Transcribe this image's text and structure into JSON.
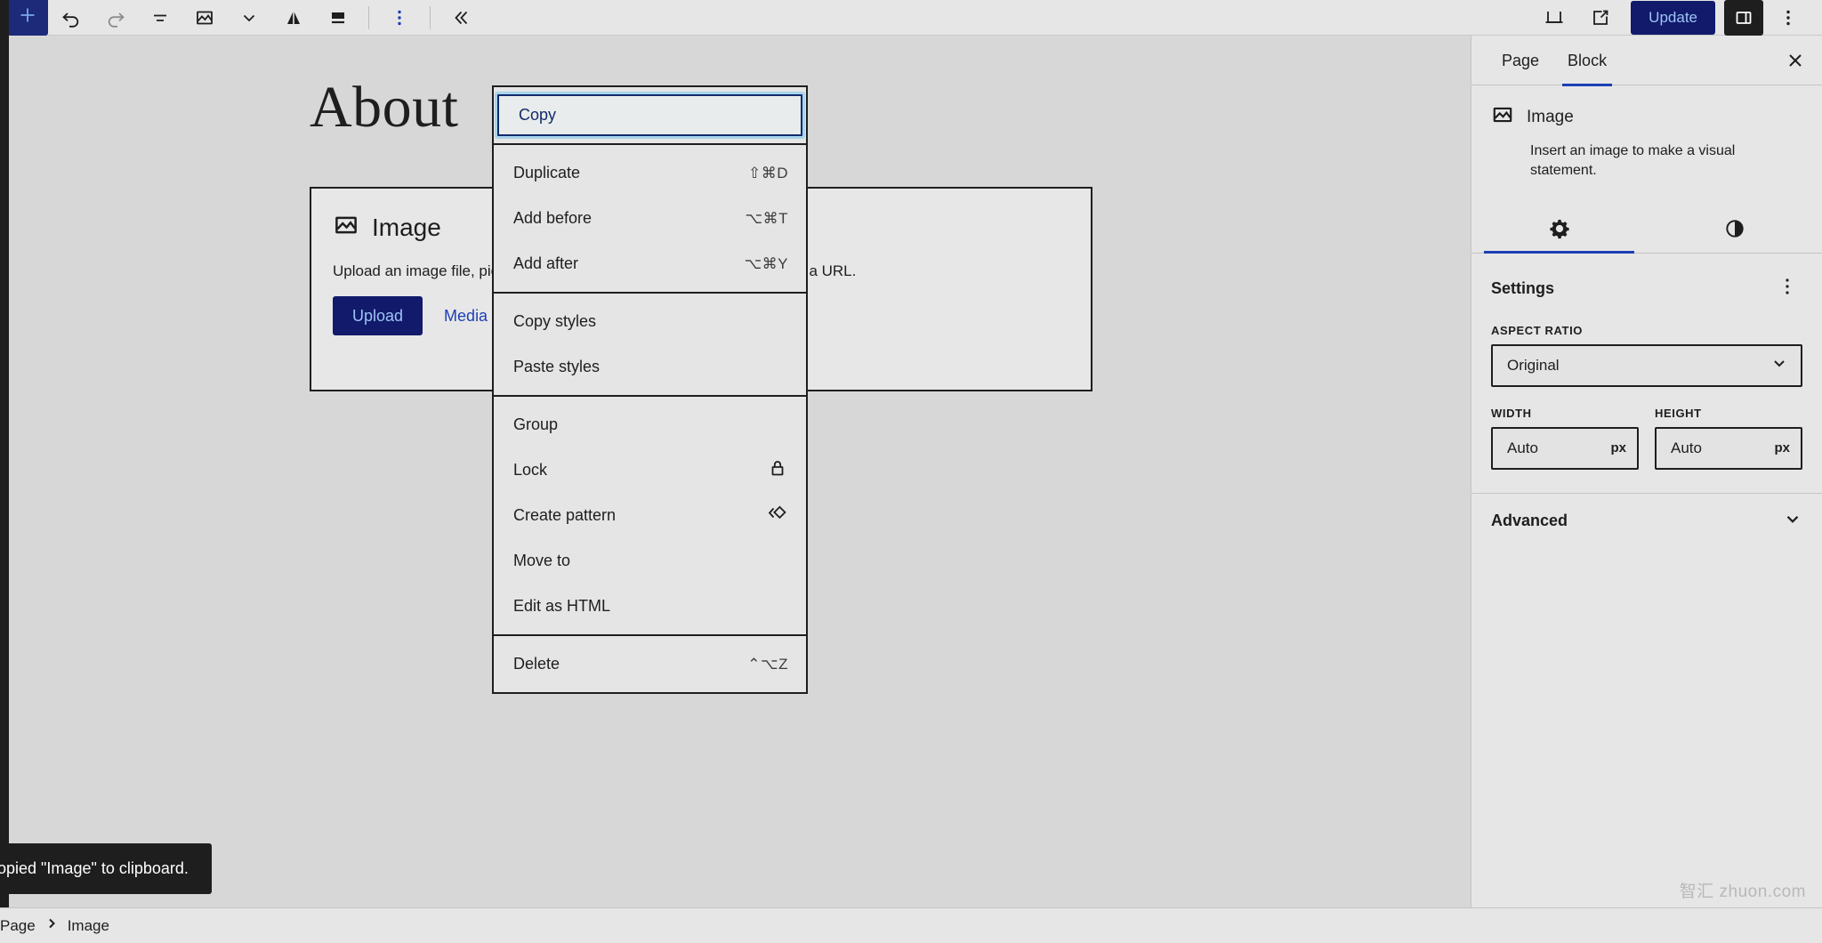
{
  "toolbar": {
    "add_block_label": "Add block",
    "undo_label": "Undo",
    "redo_label": "Redo",
    "list_view_label": "Document Overview",
    "block_icon_label": "Image",
    "block_chevron_label": "Change block type or style",
    "align_label": "Align",
    "caption_label": "Add caption",
    "options_label": "Options",
    "collapse_label": "Collapse",
    "preview_label": "Preview",
    "view_label": "View page",
    "update_label": "Update",
    "settings_panel_label": "Settings",
    "more_label": "Options"
  },
  "canvas": {
    "post_title": "About",
    "image_block": {
      "title": "Image",
      "description": "Upload an image file, pick one from your media library, or add one with a URL.",
      "upload_label": "Upload",
      "media_library_label": "Media Library"
    }
  },
  "context_menu": {
    "groups": [
      {
        "items": [
          {
            "label": "Copy",
            "shortcut": "",
            "icon": "",
            "focused": true
          }
        ]
      },
      {
        "items": [
          {
            "label": "Duplicate",
            "shortcut": "⇧⌘D",
            "icon": "",
            "focused": false
          },
          {
            "label": "Add before",
            "shortcut": "⌥⌘T",
            "icon": "",
            "focused": false
          },
          {
            "label": "Add after",
            "shortcut": "⌥⌘Y",
            "icon": "",
            "focused": false
          }
        ]
      },
      {
        "items": [
          {
            "label": "Copy styles",
            "shortcut": "",
            "icon": "",
            "focused": false
          },
          {
            "label": "Paste styles",
            "shortcut": "",
            "icon": "",
            "focused": false
          }
        ]
      },
      {
        "items": [
          {
            "label": "Group",
            "shortcut": "",
            "icon": "",
            "focused": false
          },
          {
            "label": "Lock",
            "shortcut": "",
            "icon": "lock-icon",
            "focused": false
          },
          {
            "label": "Create pattern",
            "shortcut": "",
            "icon": "pattern-icon",
            "focused": false
          },
          {
            "label": "Move to",
            "shortcut": "",
            "icon": "",
            "focused": false
          },
          {
            "label": "Edit as HTML",
            "shortcut": "",
            "icon": "",
            "focused": false
          }
        ]
      },
      {
        "items": [
          {
            "label": "Delete",
            "shortcut": "⌃⌥Z",
            "icon": "",
            "focused": false
          }
        ]
      }
    ]
  },
  "sidebar": {
    "tabs": [
      {
        "label": "Page",
        "selected": false
      },
      {
        "label": "Block",
        "selected": true
      }
    ],
    "close_label": "Close Settings",
    "block_card": {
      "title": "Image",
      "description": "Insert an image to make a visual statement."
    },
    "icon_tabs": [
      {
        "name": "settings-gear-icon",
        "selected": true
      },
      {
        "name": "styles-contrast-icon",
        "selected": false
      }
    ],
    "settings": {
      "title": "Settings",
      "kebab_label": "View options",
      "aspect_ratio_label": "Aspect ratio",
      "aspect_ratio_value": "Original",
      "width_label": "Width",
      "width_value": "Auto",
      "width_unit": "px",
      "height_label": "Height",
      "height_value": "Auto",
      "height_unit": "px"
    },
    "advanced_label": "Advanced"
  },
  "snackbar": {
    "message": "Copied \"Image\" to clipboard."
  },
  "breadcrumb": {
    "items": [
      "Page",
      "Image"
    ],
    "separator": "›"
  },
  "watermark": {
    "text": "智汇 zhuon.com"
  },
  "colors": {
    "accent_blue": "#1d3fb4",
    "button_navy": "#111a6b",
    "button_text": "#9fc4f5",
    "canvas_bg": "#d7d7d7",
    "panel_bg": "#e6e6e6",
    "menu_bg": "#e5e5e5",
    "ink": "#1e1e1e",
    "focus_ring": "#a8d4ec",
    "snackbar_bg": "#1e1e1e"
  }
}
